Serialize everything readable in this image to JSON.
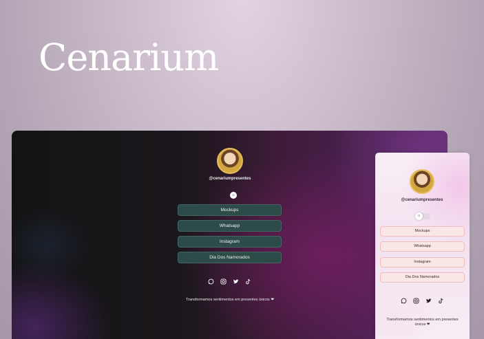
{
  "brand": "Cenarium",
  "profile": {
    "handle": "@cenariumpresentes",
    "links": [
      "Mockups",
      "Whatsapp",
      "Instagram",
      "Dia Dos Namorados"
    ],
    "tagline": "Transformamos sentimentos em presentes únicos ❤",
    "tagline_mobile_1": "Transformamos sentimentos em presentes",
    "tagline_mobile_2": "únicos ❤",
    "social_icons": [
      "whatsapp-icon",
      "instagram-icon",
      "twitter-icon",
      "tiktok-icon"
    ],
    "toggle_icon": "☼"
  },
  "colors": {
    "dark_button": "#2d4b48",
    "light_button": "#fbe6e6",
    "text_light": "#f2f2f2",
    "text_dark": "#3a2a2a"
  }
}
